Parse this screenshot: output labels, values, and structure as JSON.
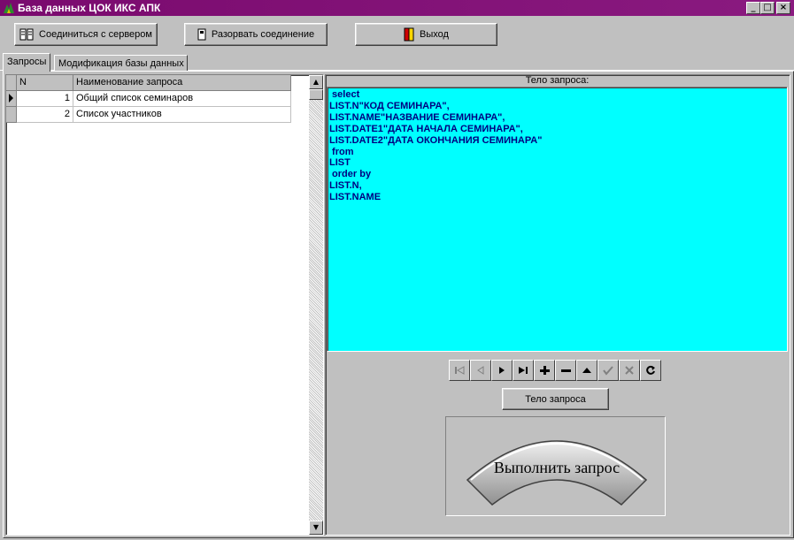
{
  "window": {
    "title": "База данных ЦОК ИКС АПК"
  },
  "toolbar": {
    "connect_label": "Соединиться с сервером",
    "disconnect_label": "Разорвать соединение",
    "exit_label": "Выход"
  },
  "tabs": [
    {
      "label": "Запросы",
      "active": true
    },
    {
      "label": "Модификация базы данных",
      "active": false
    }
  ],
  "grid": {
    "columns": [
      "N",
      "Наименование запроса"
    ],
    "rows": [
      {
        "n": "1",
        "name": "Общий список семинаров"
      },
      {
        "n": "2",
        "name": "Список участников"
      }
    ]
  },
  "query_panel": {
    "header": "Тело запроса:",
    "sql": " select\nLIST.N\"КОД СЕМИНАРА\",\nLIST.NAME\"НАЗВАНИЕ СЕМИНАРА\",\nLIST.DATE1\"ДАТА НАЧАЛА СЕМИНАРА\",\nLIST.DATE2\"ДАТА ОКОНЧАНИЯ СЕМИНАРА\"\n from\nLIST\n order by\nLIST.N,\nLIST.NAME",
    "body_button": "Тело запроса",
    "execute_button": "Выполнить запрос"
  },
  "navigator": [
    "first",
    "prior",
    "next",
    "last",
    "insert",
    "delete",
    "edit",
    "post",
    "cancel",
    "refresh"
  ],
  "colors": {
    "title_bar": "#7a0a6e",
    "sql_background": "#00ffff",
    "sql_text": "#000080",
    "face": "#c0c0c0"
  }
}
